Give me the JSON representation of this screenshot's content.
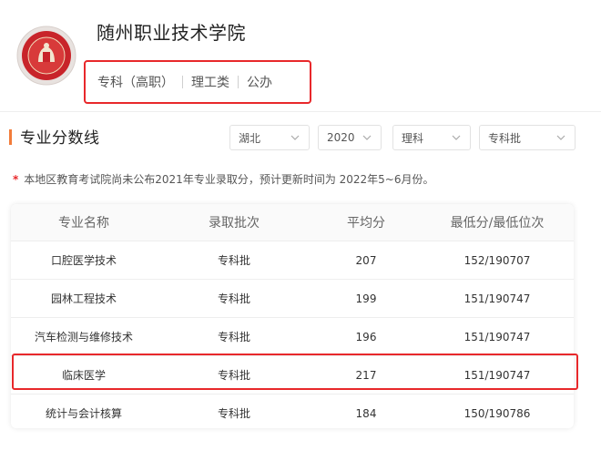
{
  "school": {
    "name": "随州职业技术学院",
    "tags": [
      "专科（高职）",
      "理工类",
      "公办"
    ]
  },
  "section": {
    "title": "专业分数线"
  },
  "filters": [
    {
      "name": "province",
      "value": "湖北"
    },
    {
      "name": "year",
      "value": "2020"
    },
    {
      "name": "subject",
      "value": "理科"
    },
    {
      "name": "batch",
      "value": "专科批"
    }
  ],
  "notice": {
    "star": "*",
    "text": "本地区教育考试院尚未公布2021年专业录取分，预计更新时间为 2022年5~6月份。"
  },
  "table": {
    "headers": [
      "专业名称",
      "录取批次",
      "平均分",
      "最低分/最低位次"
    ],
    "rows": [
      [
        "口腔医学技术",
        "专科批",
        "207",
        "152/190707"
      ],
      [
        "园林工程技术",
        "专科批",
        "199",
        "151/190747"
      ],
      [
        "汽车检测与维修技术",
        "专科批",
        "196",
        "151/190747"
      ],
      [
        "临床医学",
        "专科批",
        "217",
        "151/190747"
      ],
      [
        "统计与会计核算",
        "专科批",
        "184",
        "150/190786"
      ]
    ],
    "highlighted_row": 3
  },
  "colors": {
    "highlight": "#e8282b",
    "accent": "#f27c3a",
    "logo": "#c8242a"
  },
  "icons": {
    "dropdown": "chevron-down-icon",
    "logo": "school-emblem-icon"
  }
}
